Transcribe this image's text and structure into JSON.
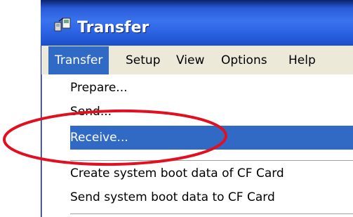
{
  "window": {
    "title": "Transfer",
    "title_icon": "cf-transfer-icon"
  },
  "menubar": {
    "items": [
      {
        "label": "Transfer",
        "active": true
      },
      {
        "label": "Setup"
      },
      {
        "label": "View"
      },
      {
        "label": "Options"
      },
      {
        "label": "Help"
      }
    ]
  },
  "dropdown": {
    "items": [
      {
        "label": "Prepare..."
      },
      {
        "label": "Send..."
      },
      {
        "label": "Receive...",
        "highlighted": true
      },
      {
        "label": "Create system boot data of CF Card"
      },
      {
        "label": "Send system boot data to CF Card"
      }
    ]
  },
  "annotation": {
    "color": "#e01020",
    "shape": "ellipse-highlight",
    "target": "Receive..."
  },
  "colors": {
    "selection": "#316ac5",
    "menu_bg": "#ece9d8",
    "titlebar": "#2a5bd7"
  }
}
